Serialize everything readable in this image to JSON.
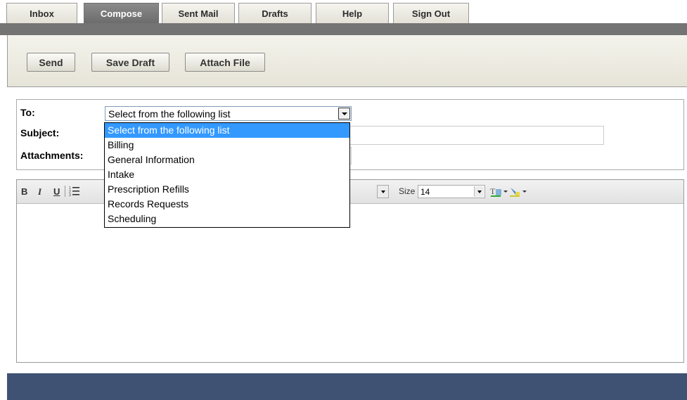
{
  "tabs": [
    {
      "label": "Inbox",
      "active": false
    },
    {
      "label": "Compose",
      "active": true
    },
    {
      "label": "Sent Mail",
      "active": false
    },
    {
      "label": "Drafts",
      "active": false
    },
    {
      "label": "Help",
      "active": false
    },
    {
      "label": "Sign Out",
      "active": false
    }
  ],
  "toolbar": {
    "send_label": "Send",
    "save_draft_label": "Save Draft",
    "attach_file_label": "Attach File"
  },
  "form": {
    "to_label": "To:",
    "to_value": "Select from the following list",
    "subject_label": "Subject:",
    "subject_value": "",
    "attachments_label": "Attachments:"
  },
  "to_dropdown": {
    "options": [
      "Select from the following list",
      "Billing",
      "General Information",
      "Intake",
      "Prescription Refills",
      "Records Requests",
      "Scheduling"
    ],
    "selected_index": 0
  },
  "editor": {
    "bold_label": "B",
    "italic_label": "I",
    "underline_label": "U",
    "size_label": "Size",
    "size_value": "14",
    "body": ""
  },
  "colors": {
    "active_tab": "#767676",
    "gray_bar": "#747474",
    "toolbar_bg": "#e9e7dc",
    "selected_option": "#3399ff",
    "footer": "#3f5273"
  }
}
